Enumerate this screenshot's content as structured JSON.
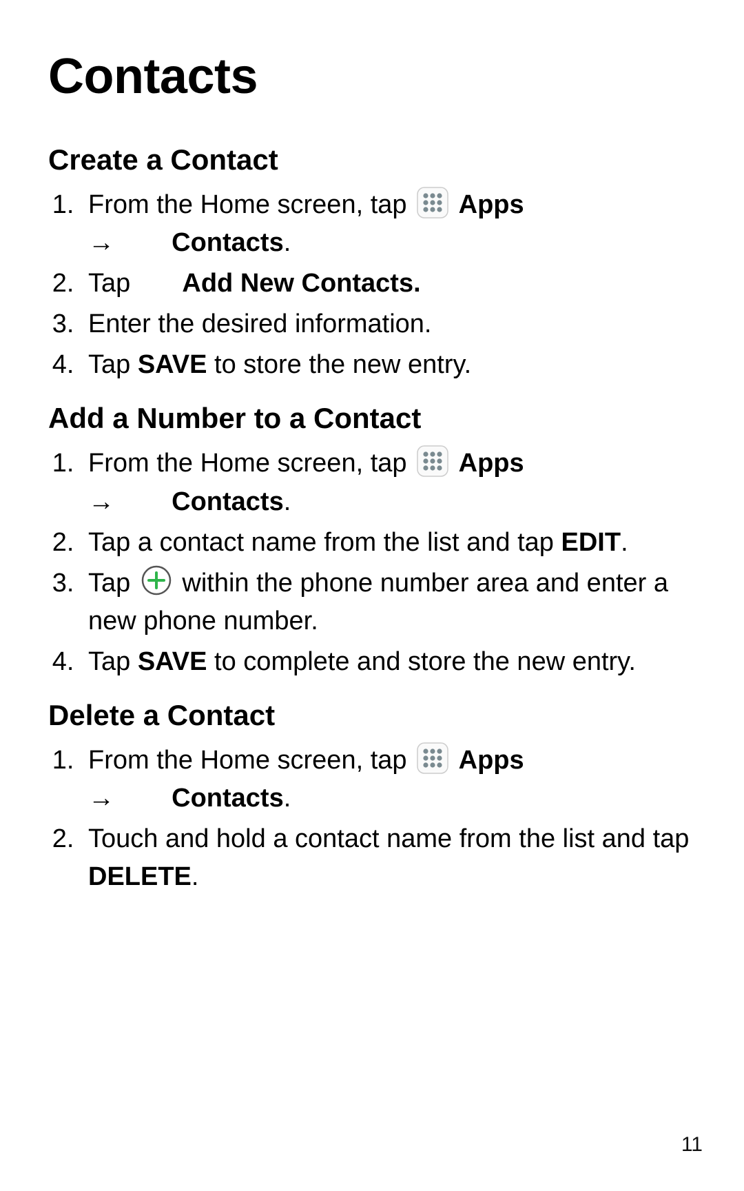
{
  "page_number": "11",
  "title": "Contacts",
  "sections": [
    {
      "heading": "Create a Contact",
      "steps": [
        {
          "pre": "From the Home screen, tap ",
          "icon1": "apps",
          "t1": "Apps",
          "arrow": true,
          "icon2": "contacts",
          "t2": "Contacts",
          "trail": "."
        },
        {
          "pre": "Tap ",
          "icon1": "add-orange",
          "t1": "Add New Contacts."
        },
        {
          "pre": "Enter the desired information."
        },
        {
          "pre": "Tap ",
          "b1": "SAVE",
          "post": " to store the new entry."
        }
      ]
    },
    {
      "heading": "Add a Number to a Contact",
      "steps": [
        {
          "pre": "From the Home screen, tap ",
          "icon1": "apps",
          "t1": "Apps",
          "arrow": true,
          "icon2": "contacts",
          "t2": "Contacts",
          "trail": "."
        },
        {
          "pre": "Tap a contact name from the list and tap ",
          "b1": "EDIT",
          "post": "."
        },
        {
          "pre": "Tap ",
          "icon1": "add-green",
          "post": " within the phone number area and enter a new phone number."
        },
        {
          "pre": "Tap ",
          "b1": "SAVE",
          "post": " to complete and store the new entry."
        }
      ]
    },
    {
      "heading": "Delete a Contact",
      "steps": [
        {
          "pre": "From the Home screen, tap ",
          "icon1": "apps",
          "t1": "Apps",
          "arrow": true,
          "icon2": "contacts",
          "t2": "Contacts",
          "trail": "."
        },
        {
          "pre": "Touch and hold a contact name from the list and tap ",
          "b1": "DELETE",
          "post": "."
        }
      ]
    }
  ],
  "icons": {
    "arrow_glyph": "→"
  }
}
